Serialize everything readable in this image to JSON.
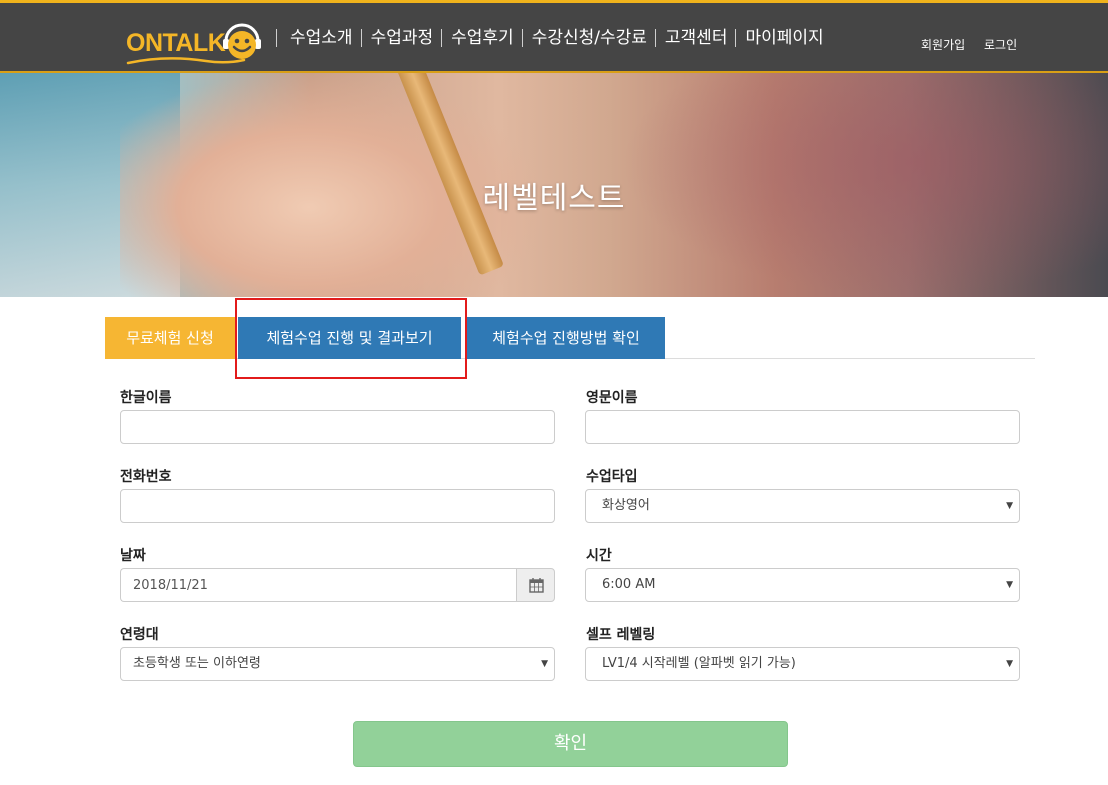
{
  "header": {
    "logo_text": "ONTALK",
    "nav": [
      "수업소개",
      "수업과정",
      "수업후기",
      "수강신청/수강료",
      "고객센터",
      "마이페이지"
    ],
    "signup_label": "회원가입",
    "login_label": "로그인"
  },
  "hero": {
    "title": "레벨테스트"
  },
  "tabs": [
    "무료체험 신청",
    "체험수업 진행 및 결과보기",
    "체험수업 진행방법 확인"
  ],
  "form": {
    "korean_name": {
      "label": "한글이름",
      "value": ""
    },
    "english_name": {
      "label": "영문이름",
      "value": ""
    },
    "phone": {
      "label": "전화번호",
      "value": ""
    },
    "class_type": {
      "label": "수업타입",
      "value": "화상영어"
    },
    "date": {
      "label": "날짜",
      "value": "2018/11/21"
    },
    "time": {
      "label": "시간",
      "value": "6:00 AM"
    },
    "age_group": {
      "label": "연령대",
      "value": "초등학생 또는 이하연령"
    },
    "self_level": {
      "label": "셀프 레벨링",
      "value": "LV1/4 시작레벨 (알파벳 읽기 가능)"
    },
    "submit_label": "확인"
  },
  "colors": {
    "header_bg": "#454545",
    "accent_yellow": "#f6b633",
    "tab_blue": "#2f79b5",
    "confirm_green": "#92d199",
    "highlight_red": "#e21b1b"
  }
}
